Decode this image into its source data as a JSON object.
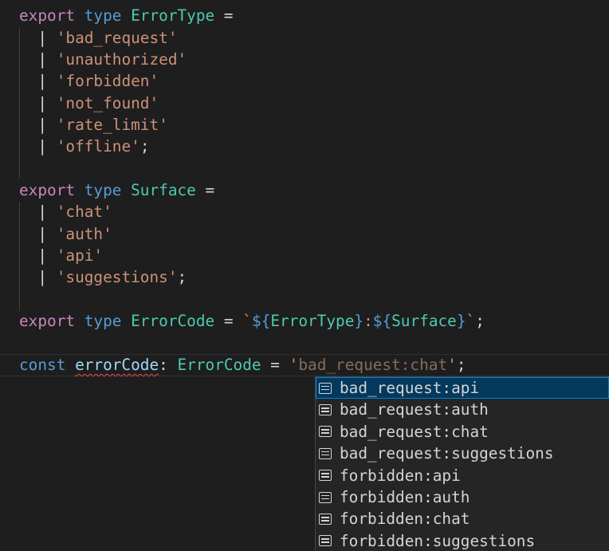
{
  "code": {
    "block1": {
      "export": "export",
      "type_kw": "type",
      "name": "ErrorType",
      "eq": "=",
      "members": [
        "'bad_request'",
        "'unauthorized'",
        "'forbidden'",
        "'not_found'",
        "'rate_limit'",
        "'offline'"
      ],
      "terminator": ";"
    },
    "block2": {
      "export": "export",
      "type_kw": "type",
      "name": "Surface",
      "eq": "=",
      "members": [
        "'chat'",
        "'auth'",
        "'api'",
        "'suggestions'"
      ],
      "terminator": ";"
    },
    "block3": {
      "export": "export",
      "type_kw": "type",
      "name": "ErrorCode",
      "eq": "=",
      "tick_open": "`",
      "dollar1": "${",
      "ref1": "ErrorType",
      "close1": "}",
      "colon": ":",
      "dollar2": "${",
      "ref2": "Surface",
      "close2": "}",
      "tick_close": "`",
      "terminator": ";"
    },
    "block4": {
      "const_kw": "const",
      "var": "errorCode",
      "colon": ":",
      "type": "ErrorCode",
      "eq": "=",
      "quote_open": "'",
      "ghost_value": "bad_request:chat",
      "quote_close": "'",
      "terminator": ";"
    },
    "pipe": "|"
  },
  "suggestions": {
    "selected_index": 0,
    "items": [
      {
        "label": "bad_request:api",
        "icon": "text-value-icon"
      },
      {
        "label": "bad_request:auth",
        "icon": "text-value-icon"
      },
      {
        "label": "bad_request:chat",
        "icon": "text-value-icon"
      },
      {
        "label": "bad_request:suggestions",
        "icon": "text-value-icon"
      },
      {
        "label": "forbidden:api",
        "icon": "text-value-icon"
      },
      {
        "label": "forbidden:auth",
        "icon": "text-value-icon"
      },
      {
        "label": "forbidden:chat",
        "icon": "text-value-icon"
      },
      {
        "label": "forbidden:suggestions",
        "icon": "text-value-icon"
      }
    ]
  },
  "colors": {
    "background": "#1e1e1e",
    "keyword_export": "#c586c0",
    "keyword": "#569cd6",
    "type_name": "#4ec9b0",
    "string": "#ce9178",
    "variable": "#9cdcfe",
    "selection": "#04395e",
    "error_squiggle": "#f14c4c"
  }
}
